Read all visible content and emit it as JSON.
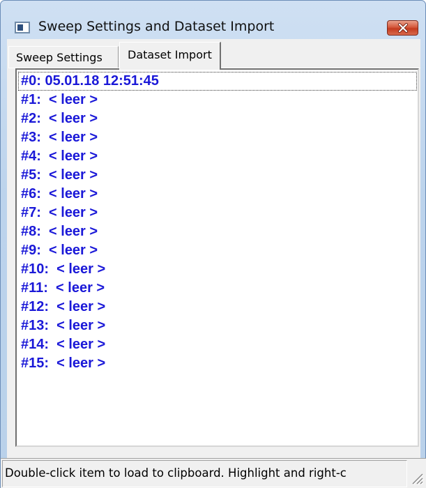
{
  "window": {
    "title": "Sweep Settings and Dataset Import",
    "icon": "app-window-icon",
    "close_icon": "close-icon"
  },
  "tabs": [
    {
      "label": "Sweep Settings",
      "selected": false
    },
    {
      "label": "Dataset Import",
      "selected": true
    }
  ],
  "datasets": {
    "color": "#1a18d8",
    "focused_index": 0,
    "items": [
      "#0: 05.01.18 12:51:45",
      "#1:  < leer >",
      "#2:  < leer >",
      "#3:  < leer >",
      "#4:  < leer >",
      "#5:  < leer >",
      "#6:  < leer >",
      "#7:  < leer >",
      "#8:  < leer >",
      "#9:  < leer >",
      "#10:  < leer >",
      "#11:  < leer >",
      "#12:  < leer >",
      "#13:  < leer >",
      "#14:  < leer >",
      "#15:  < leer >"
    ]
  },
  "statusbar": {
    "text": "Double-click item to load to clipboard. Highlight and right-c",
    "grip_icon": "size-grip-icon"
  },
  "colors": {
    "close_button": "#c43b1f",
    "frame": "#b9d1ea",
    "client": "#f0f0f0"
  }
}
